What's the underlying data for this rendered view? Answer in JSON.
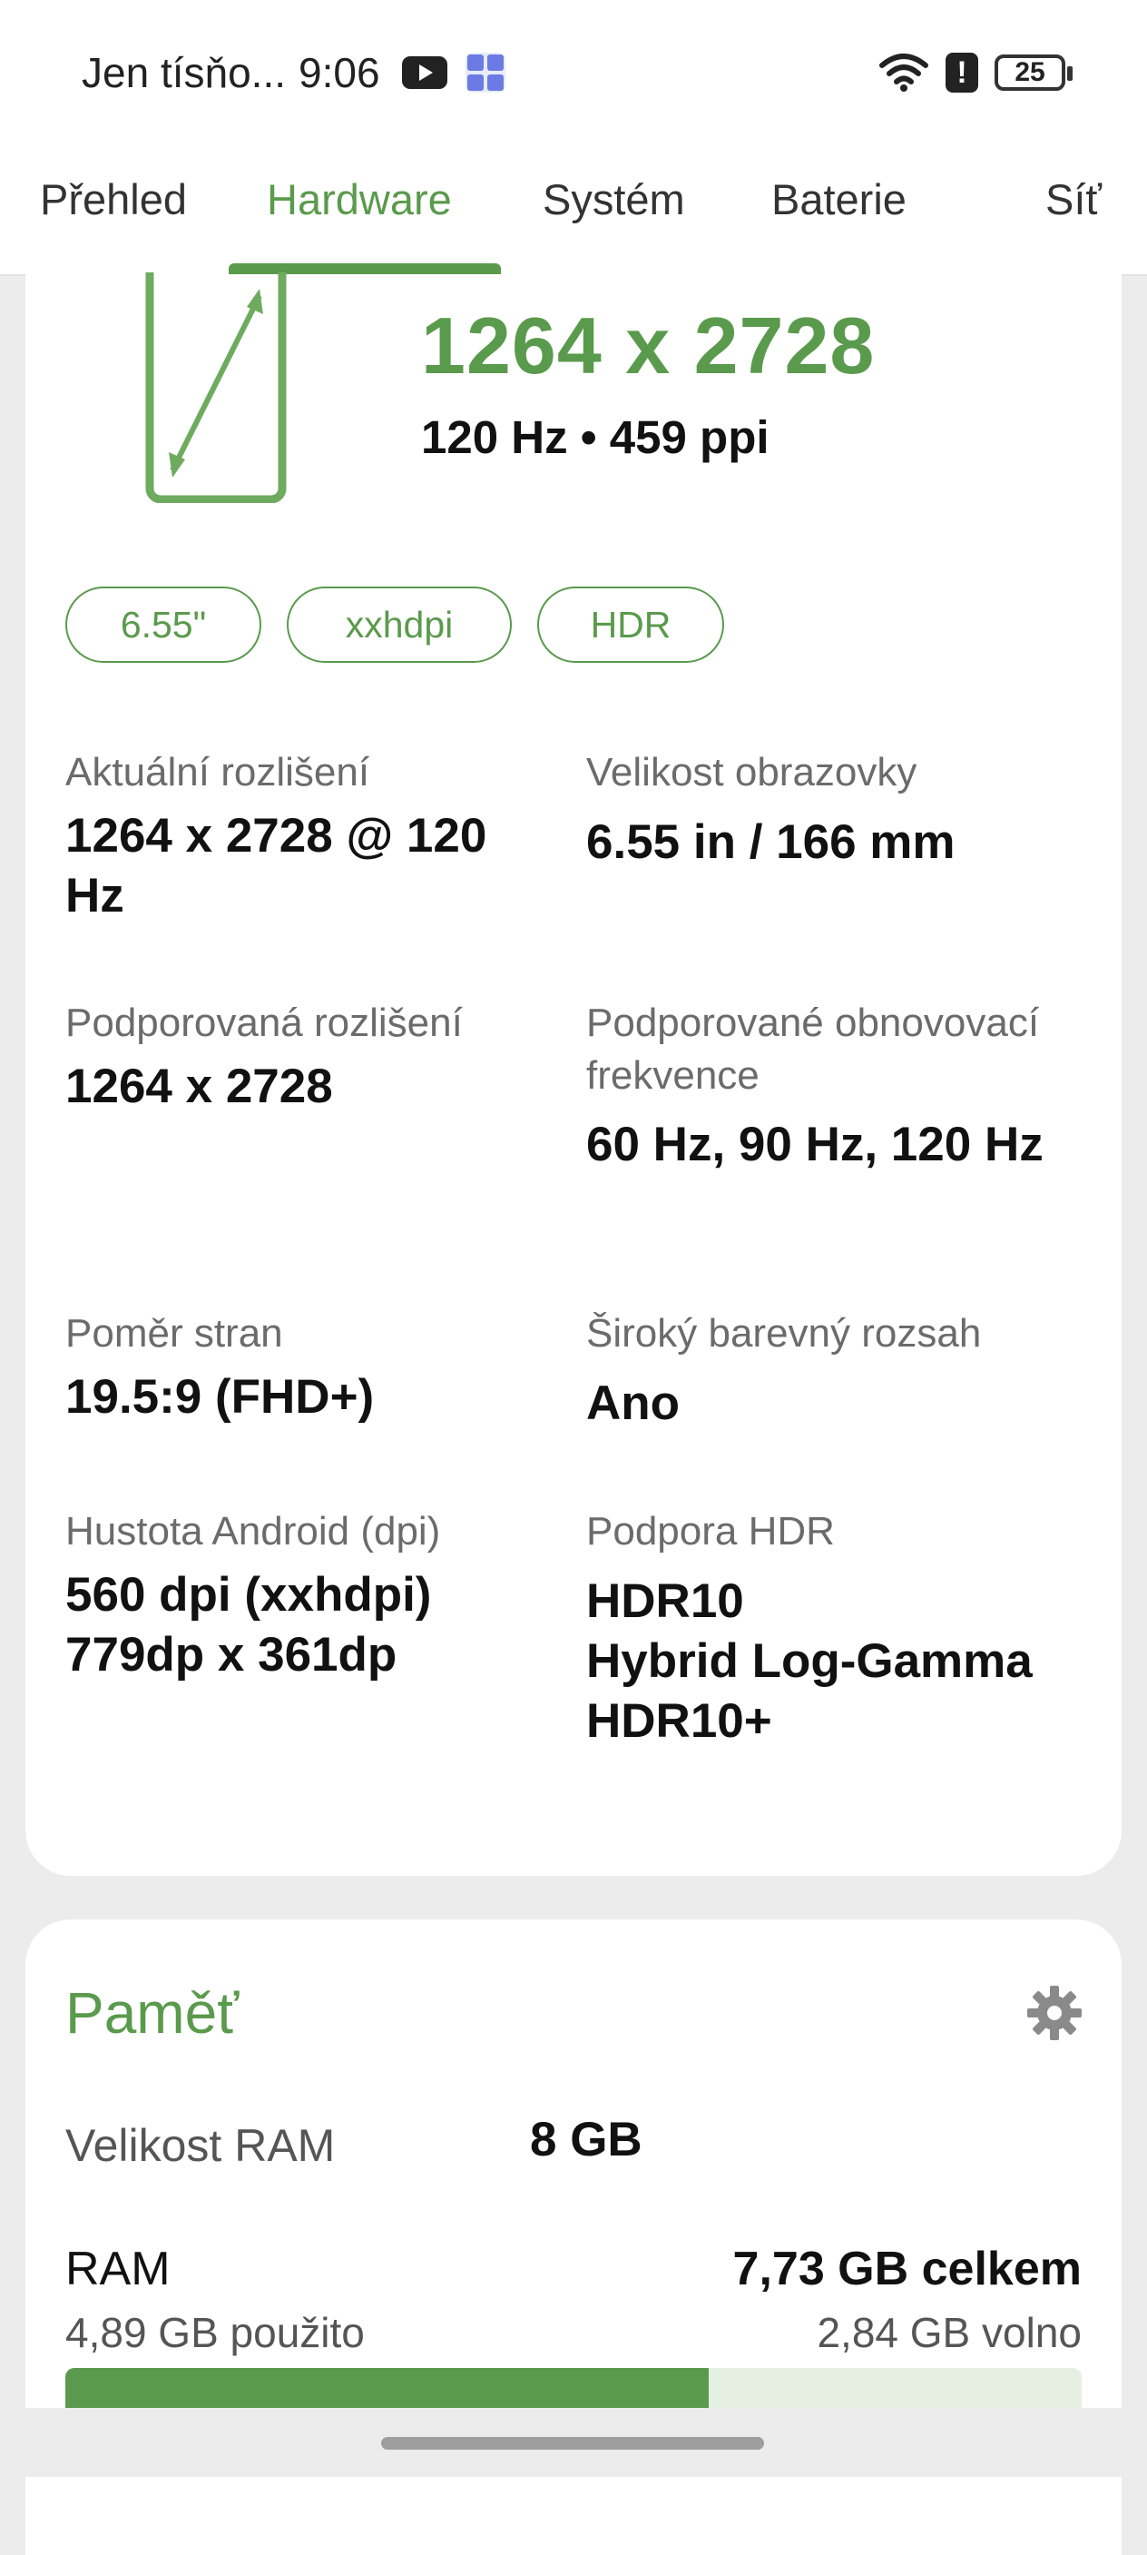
{
  "status_bar": {
    "carrier": "Jen tísňo...",
    "time": "9:06",
    "battery": "25"
  },
  "tabs": [
    {
      "label": "Přehled",
      "active": false
    },
    {
      "label": "Hardware",
      "active": true
    },
    {
      "label": "Systém",
      "active": false
    },
    {
      "label": "Baterie",
      "active": false
    },
    {
      "label": "Síť",
      "active": false
    }
  ],
  "display": {
    "resolution": "1264 x 2728",
    "subtitle": "120 Hz • 459 ppi",
    "chips": [
      "6.55\"",
      "xxhdpi",
      "HDR"
    ],
    "current_resolution": {
      "label": "Aktuální rozlišení",
      "value": "1264 x 2728 @ 120 Hz"
    },
    "screen_size": {
      "label": "Velikost obrazovky",
      "value": "6.55 in / 166 mm"
    },
    "supported_resolutions": {
      "label": "Podporovaná rozlišení",
      "value": "1264 x 2728"
    },
    "refresh_rates": {
      "label": "Podporované obnovovací frekvence",
      "value": "60 Hz, 90 Hz, 120 Hz"
    },
    "aspect_ratio": {
      "label": "Poměr stran",
      "value": "19.5:9 (FHD+)"
    },
    "wide_color": {
      "label": "Široký barevný rozsah",
      "value": "Ano"
    },
    "density": {
      "label": "Hustota Android (dpi)",
      "value_line1": "560 dpi (xxhdpi)",
      "value_line2": "779dp x 361dp"
    },
    "hdr": {
      "label": "Podpora HDR",
      "values": [
        "HDR10",
        "Hybrid Log-Gamma",
        "HDR10+"
      ]
    }
  },
  "memory": {
    "title": "Paměť",
    "ram_size_label": "Velikost RAM",
    "ram_size_value": "8 GB",
    "ram_label": "RAM",
    "ram_total": "7,73 GB celkem",
    "ram_used": "4,89 GB použito",
    "ram_free": "2,84 GB volno",
    "ram_used_fraction": 0.6326
  },
  "colors": {
    "accent": "#5a9a4c",
    "bar_track": "#e6f0e2",
    "background": "#ececec"
  }
}
